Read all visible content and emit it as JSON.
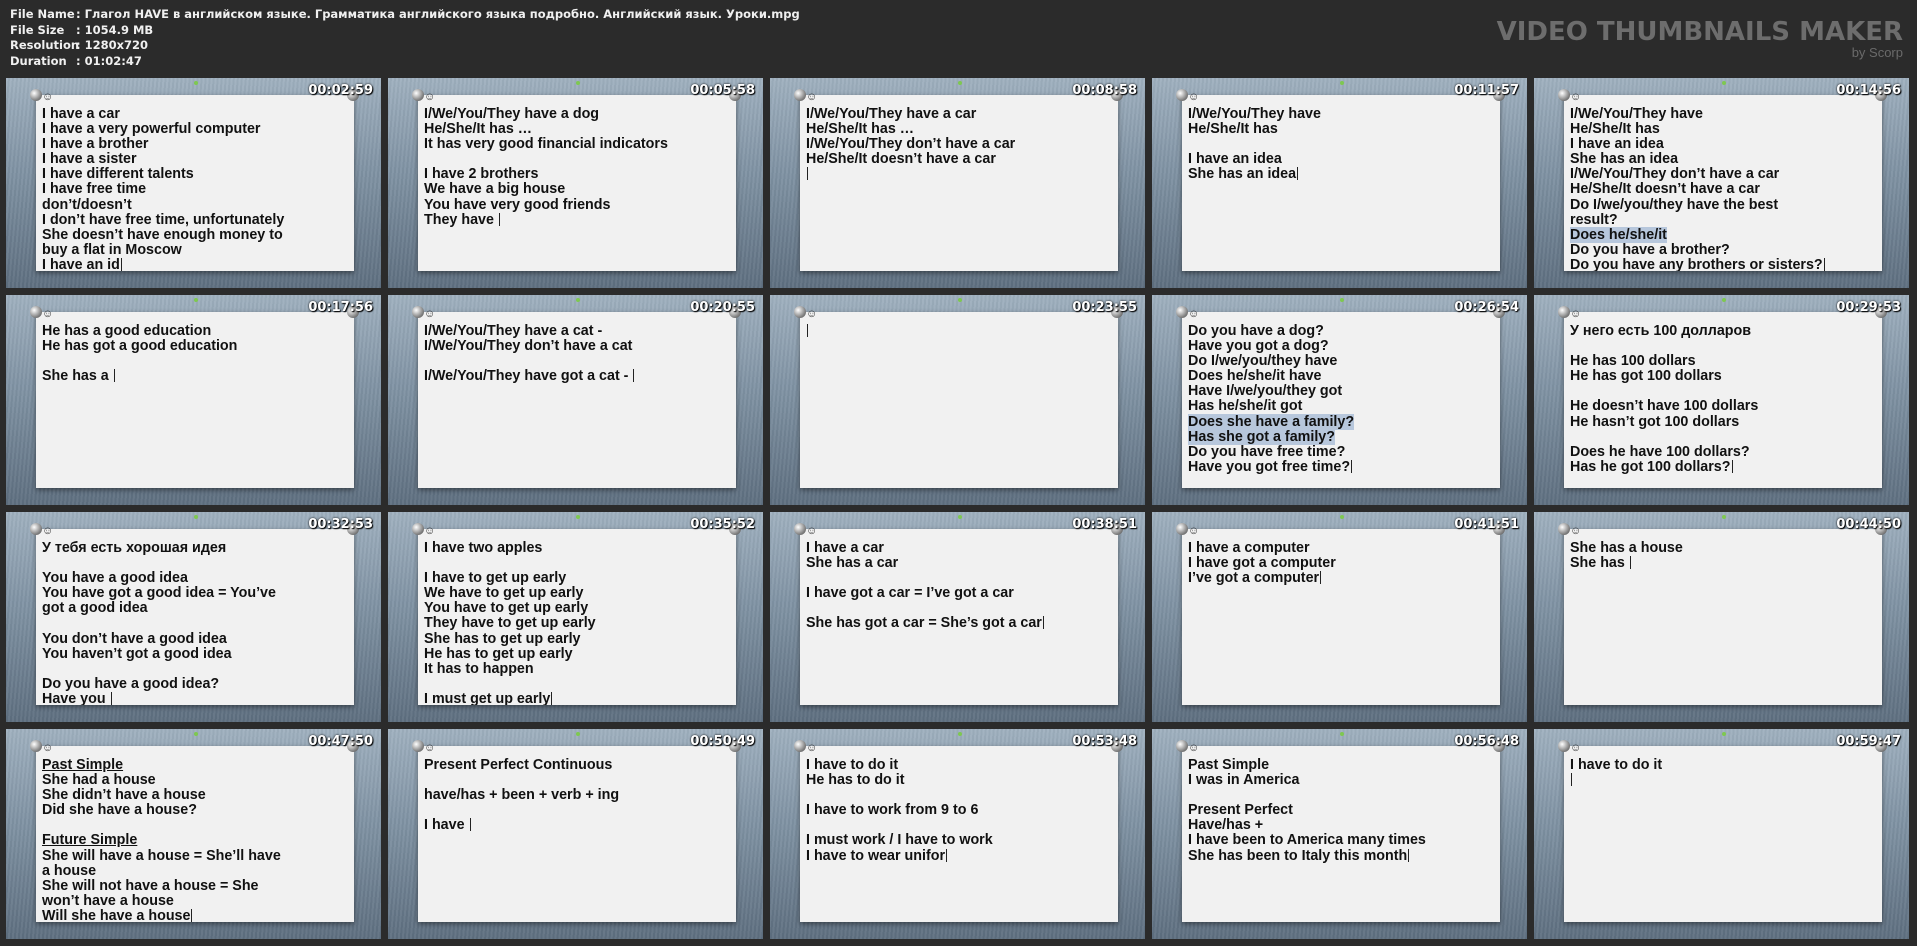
{
  "header": {
    "fields": [
      {
        "label": "File Name",
        "value": "Глагол HAVE в английском языке. Грамматика английского языка подробно. Английский язык. Уроки.mpg"
      },
      {
        "label": "File Size",
        "value": "1054.9 MB"
      },
      {
        "label": "Resolution",
        "value": "1280x720"
      },
      {
        "label": "Duration",
        "value": "01:02:47"
      }
    ],
    "brand": "VIDEO THUMBNAILS MAKER",
    "brand_sub": "by Scorp"
  },
  "thumbnails": [
    {
      "time": "00:02:59",
      "lines": [
        "I have a car",
        "I have a very powerful computer",
        "I have a brother",
        "I have a sister",
        "I have different talents",
        "I have free time",
        "don’t/doesn’t",
        "I don’t have free time, unfortunately",
        "She doesn’t have enough money to",
        "buy a flat in Moscow",
        "I have an id"
      ],
      "highlight": [],
      "underline": []
    },
    {
      "time": "00:05:58",
      "lines": [
        "I/We/You/They have a dog",
        "He/She/It has …",
        "It has very good financial indicators",
        "",
        "I have 2 brothers",
        "We have a big house",
        "You have very good friends",
        "They have "
      ],
      "highlight": [],
      "underline": []
    },
    {
      "time": "00:08:58",
      "lines": [
        "I/We/You/They have a car",
        "He/She/It has …",
        "I/We/You/They don’t have a car",
        "He/She/It doesn’t have a car",
        ""
      ],
      "highlight": [],
      "underline": []
    },
    {
      "time": "00:11:57",
      "lines": [
        "I/We/You/They have",
        "He/She/It has",
        "",
        "I have an idea",
        "She has an idea"
      ],
      "highlight": [],
      "underline": []
    },
    {
      "time": "00:14:56",
      "lines": [
        "I/We/You/They have",
        "He/She/It has",
        "I have an idea",
        "She has an idea",
        "I/We/You/They don’t have a car",
        "He/She/It doesn’t have a car",
        "Do I/we/you/they have the best",
        "result?",
        "Does he/she/it",
        "Do you have a brother?",
        "Do you have any brothers or sisters?"
      ],
      "highlight": [
        8
      ],
      "underline": []
    },
    {
      "time": "00:17:56",
      "lines": [
        "He has a good education",
        "He has got a good education",
        "",
        "She has a "
      ],
      "highlight": [],
      "underline": []
    },
    {
      "time": "00:20:55",
      "lines": [
        "I/We/You/They have a cat -",
        "I/We/You/They don’t have a cat",
        "",
        "I/We/You/They have got a cat - "
      ],
      "highlight": [],
      "underline": []
    },
    {
      "time": "00:23:55",
      "lines": [
        ""
      ],
      "highlight": [],
      "underline": []
    },
    {
      "time": "00:26:54",
      "lines": [
        "Do you have a dog?",
        "Have you got a dog?",
        "Do I/we/you/they have",
        "Does he/she/it have",
        "Have I/we/you/they got",
        "Has he/she/it got",
        "Does she have a family?",
        "Has she got a family?",
        "Do you have free time?",
        "Have you got free time?"
      ],
      "highlight": [
        6,
        7
      ],
      "underline": []
    },
    {
      "time": "00:29:53",
      "lines": [
        "У него есть 100 долларов",
        "",
        "He has 100 dollars",
        "He has got 100 dollars",
        "",
        "He doesn’t have 100 dollars",
        "He hasn’t got 100 dollars",
        "",
        "Does he have 100 dollars?",
        "Has he got 100 dollars?"
      ],
      "highlight": [],
      "underline": []
    },
    {
      "time": "00:32:53",
      "lines": [
        "У тебя есть хорошая идея",
        "",
        "You have a good idea",
        "You have got a good idea = You’ve",
        "got a good idea",
        "",
        "You don’t have a good idea",
        "You haven’t got a good idea",
        "",
        "Do you have a good idea?",
        "Have you "
      ],
      "highlight": [],
      "underline": []
    },
    {
      "time": "00:35:52",
      "lines": [
        "I have two apples",
        "",
        "I have to get up early",
        "We have to get up early",
        "You have to get up early",
        "They have to get up early",
        "She has to get up early",
        "He has to get up early",
        "It has to happen",
        "",
        "I must get up early"
      ],
      "highlight": [],
      "underline": []
    },
    {
      "time": "00:38:51",
      "lines": [
        "I have a car",
        "She has a car",
        "",
        "I have got a car = I’ve got a car",
        "",
        "She has got a car = She’s got a car"
      ],
      "highlight": [],
      "underline": []
    },
    {
      "time": "00:41:51",
      "lines": [
        "I have a computer",
        "I have got a computer",
        "I’ve got a computer"
      ],
      "highlight": [],
      "underline": []
    },
    {
      "time": "00:44:50",
      "lines": [
        "She has a house",
        "She has "
      ],
      "highlight": [],
      "underline": []
    },
    {
      "time": "00:47:50",
      "lines": [
        "Past Simple",
        "She had a house",
        "She didn’t have a house",
        "Did she have a house?",
        "",
        "Future Simple",
        "She will have a house = She’ll have",
        "a house",
        "She will not have a house = She",
        "won’t have a house",
        "Will she have a house"
      ],
      "highlight": [],
      "underline": [
        0,
        5
      ]
    },
    {
      "time": "00:50:49",
      "lines": [
        "Present Perfect Continuous",
        "",
        "have/has + been + verb + ing",
        "",
        "I have "
      ],
      "highlight": [],
      "underline": []
    },
    {
      "time": "00:53:48",
      "lines": [
        "I have to do it",
        "He has to do it",
        "",
        "I have to work from 9 to 6",
        "",
        "I must work / I have to work",
        "I have to wear unifor"
      ],
      "highlight": [],
      "underline": []
    },
    {
      "time": "00:56:48",
      "lines": [
        "Past Simple",
        "I was in America",
        "",
        "Present Perfect",
        "Have/has + ",
        "I have been to America many times",
        "She has been to Italy this month"
      ],
      "highlight": [],
      "underline": []
    },
    {
      "time": "00:59:47",
      "lines": [
        "I have to do it",
        ""
      ],
      "highlight": [],
      "underline": []
    }
  ],
  "colors": {
    "background": "#2b2b2b",
    "highlight": "#b7c7dc",
    "paper": "#f1f1f1"
  },
  "icons": [
    "pushpin-icon",
    "smiley-icon"
  ]
}
